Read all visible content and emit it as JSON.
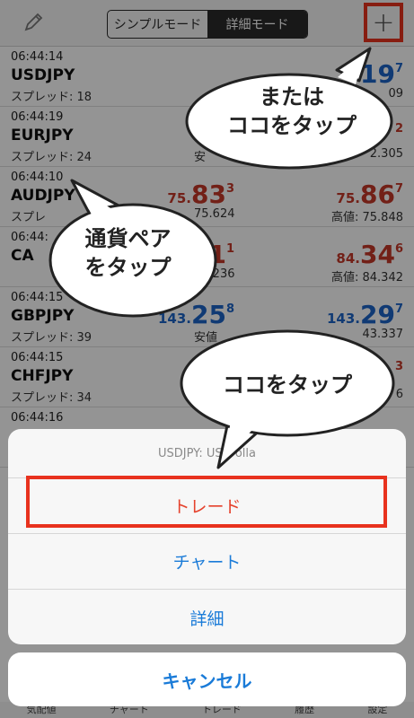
{
  "header": {
    "segments": [
      {
        "label": "シンプルモード",
        "active": false
      },
      {
        "label": "詳細モード",
        "active": true
      }
    ],
    "plus_icon": "plus-icon",
    "edit_icon": "pencil-icon"
  },
  "rows": [
    {
      "time": "06:44:14",
      "symbol": "USDJPY",
      "spread": "スプレッド: 18",
      "sub_bid": "",
      "sub_ask": "09",
      "ask_pre": "",
      "ask_big": "19",
      "ask_sup": "7",
      "bid_pre": "",
      "bid_big": "",
      "bid_sup": "",
      "color": "blue"
    },
    {
      "time": "06:44:19",
      "symbol": "EURJPY",
      "spread": "スプレッド: 24",
      "sub_bid": "安",
      "sub_ask": "2.305",
      "ask_pre": "",
      "ask_big": "",
      "ask_sup": "2",
      "bid_pre": "",
      "bid_big": "",
      "bid_sup": "",
      "color": "red"
    },
    {
      "time": "06:44:10",
      "symbol": "AUDJPY",
      "spread": "スプレ",
      "sub_bid": "75.624",
      "sub_ask": "高値: 75.848",
      "bid_pre": "75.",
      "bid_big": "83",
      "bid_sup": "3",
      "ask_pre": "75.",
      "ask_big": "86",
      "ask_sup": "7",
      "color": "red"
    },
    {
      "time": "06:44:",
      "symbol": "CA",
      "spread": "",
      "sub_bid": "84.236",
      "sub_ask": "高値: 84.342",
      "bid_pre": "",
      "bid_big": "31",
      "bid_sup": "1",
      "ask_pre": "84.",
      "ask_big": "34",
      "ask_sup": "6",
      "color": "red"
    },
    {
      "time": "06:44:15",
      "symbol": "GBPJPY",
      "spread": "スプレッド: 39",
      "sub_bid": "安値",
      "sub_ask": "43.337",
      "bid_pre": "143.",
      "bid_big": "25",
      "bid_sup": "8",
      "ask_pre": "143.",
      "ask_big": "29",
      "ask_sup": "7",
      "color": "blue"
    },
    {
      "time": "06:44:15",
      "symbol": "CHFJPY",
      "spread": "スプレッド: 34",
      "sub_bid": "",
      "sub_ask": "6",
      "bid_pre": "",
      "bid_big": "",
      "bid_sup": "",
      "ask_pre": "",
      "ask_big": "",
      "ask_sup": "3",
      "color": "red"
    },
    {
      "time": "06:44:16",
      "symbol": "",
      "spread": "",
      "sub_bid": "",
      "sub_ask": "",
      "bid_pre": "",
      "bid_big": "",
      "bid_sup": "",
      "ask_pre": "",
      "ask_big": "",
      "ask_sup": "",
      "color": "red"
    }
  ],
  "sheet": {
    "title": "USDJPY: US Dolla",
    "trade": "トレード",
    "chart": "チャート",
    "detail": "詳細",
    "cancel": "キャンセル"
  },
  "callouts": {
    "top_right": [
      "または",
      "ココをタップ"
    ],
    "left": [
      "通貨ペア",
      "をタップ"
    ],
    "bottom": [
      "ココをタップ"
    ]
  },
  "tabbar": [
    "気配値",
    "チャート",
    "トレード",
    "履歴",
    "設定"
  ],
  "colors": {
    "highlight": "#e8321e",
    "price_up": "#1c64c8",
    "price_down": "#c43728",
    "action_blue": "#1a7bd8"
  }
}
